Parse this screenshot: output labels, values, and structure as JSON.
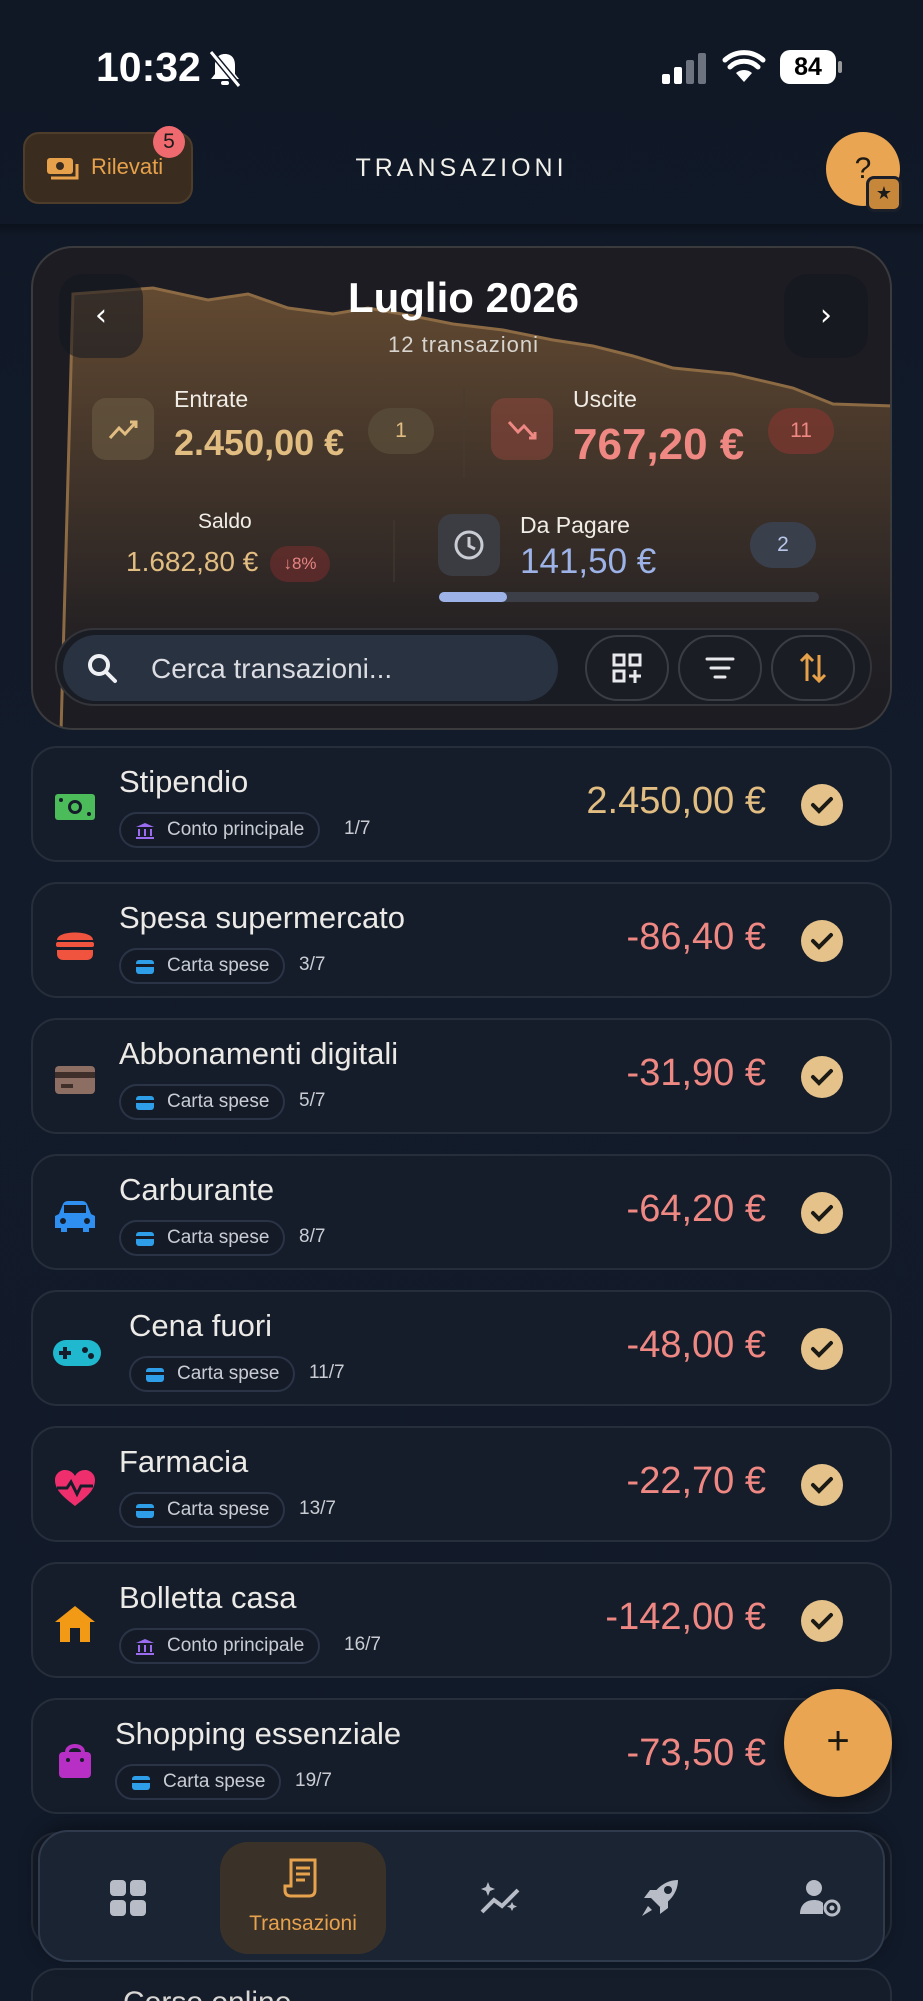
{
  "status_bar": {
    "time": "10:32",
    "battery": "84"
  },
  "header": {
    "detected_label": "Rilevati",
    "detected_badge": "5",
    "title": "TRANSAZIONI",
    "help_symbol": "?",
    "help_star": "★"
  },
  "summary": {
    "month": "Luglio 2026",
    "count_label": "12 transazioni",
    "prev_symbol": "‹",
    "next_symbol": "›",
    "income": {
      "label": "Entrate",
      "value": "2.450,00 €",
      "count": "1"
    },
    "expense": {
      "label": "Uscite",
      "value": "767,20 €",
      "count": "11"
    },
    "balance": {
      "label": "Saldo",
      "value": "1.682,80 €",
      "change": "↓8%"
    },
    "due": {
      "label": "Da Pagare",
      "value": "141,50 €",
      "count": "2",
      "progress": 0.18
    },
    "colors": {
      "income": "#e1bd82",
      "expense": "#ef8883",
      "due": "#9db3e8",
      "accent": "#e9a552"
    }
  },
  "search": {
    "placeholder": "Cerca transazioni..."
  },
  "transactions": [
    {
      "title": "Stipendio",
      "account": "Conto principale",
      "account_icon": "bank-icon",
      "date": "1/7",
      "amount": "2.450,00 €",
      "type": "income",
      "icon": "money-icon",
      "icon_color": "#4cbb5a"
    },
    {
      "title": "Spesa supermercato",
      "account": "Carta spese",
      "account_icon": "card-icon",
      "date": "3/7",
      "amount": "-86,40 €",
      "type": "expense",
      "icon": "burger-icon",
      "icon_color": "#f0533e"
    },
    {
      "title": "Abbonamenti digitali",
      "account": "Carta spese",
      "account_icon": "card-icon",
      "date": "5/7",
      "amount": "-31,90 €",
      "type": "expense",
      "icon": "credit-card-icon",
      "icon_color": "#8d6e63"
    },
    {
      "title": "Carburante",
      "account": "Carta spese",
      "account_icon": "card-icon",
      "date": "8/7",
      "amount": "-64,20 €",
      "type": "expense",
      "icon": "car-icon",
      "icon_color": "#2f8ff0"
    },
    {
      "title": "Cena fuori",
      "account": "Carta spese",
      "account_icon": "card-icon",
      "date": "11/7",
      "amount": "-48,00 €",
      "type": "expense",
      "icon": "gamepad-icon",
      "icon_color": "#1fb8cf"
    },
    {
      "title": "Farmacia",
      "account": "Carta spese",
      "account_icon": "card-icon",
      "date": "13/7",
      "amount": "-22,70 €",
      "type": "expense",
      "icon": "heart-pulse-icon",
      "icon_color": "#ef2f6d"
    },
    {
      "title": "Bolletta casa",
      "account": "Conto principale",
      "account_icon": "bank-icon",
      "date": "16/7",
      "amount": "-142,00 €",
      "type": "expense",
      "icon": "house-icon",
      "icon_color": "#f29a16"
    },
    {
      "title": "Shopping essenziale",
      "account": "Carta spese",
      "account_icon": "card-icon",
      "date": "19/7",
      "amount": "-73,50 €",
      "type": "expense",
      "icon": "shopping-bag-icon",
      "icon_color": "#b72fc4"
    }
  ],
  "fab": {
    "symbol": "+"
  },
  "nav": {
    "items": [
      {
        "name": "dashboard",
        "label": ""
      },
      {
        "name": "transazioni",
        "label": "Transazioni"
      },
      {
        "name": "insights",
        "label": ""
      },
      {
        "name": "goals",
        "label": ""
      },
      {
        "name": "settings",
        "label": ""
      }
    ]
  },
  "peek": {
    "title": "Corso online"
  }
}
